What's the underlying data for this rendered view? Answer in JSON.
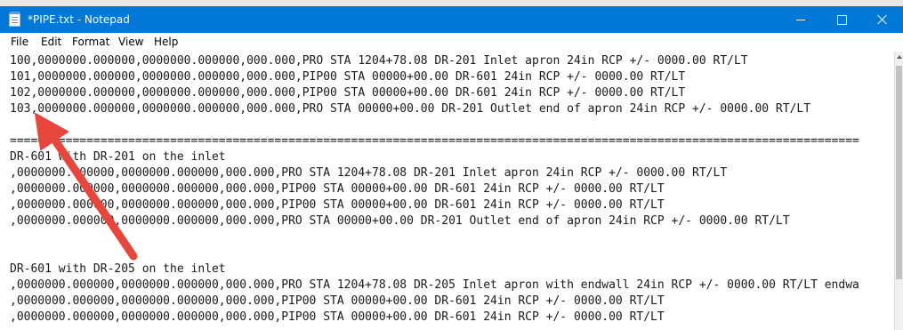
{
  "window": {
    "title": "*PIPE.txt - Notepad",
    "icon": "notepad-icon",
    "accent_color": "#0078d7"
  },
  "menu": {
    "items": [
      "File",
      "Edit",
      "Format",
      "View",
      "Help"
    ]
  },
  "editor": {
    "lines": [
      "100,0000000.000000,0000000.000000,000.000,PRO STA 1204+78.08 DR-201 Inlet apron 24in RCP +/- 0000.00 RT/LT",
      "101,0000000.000000,0000000.000000,000.000,PIP00 STA 00000+00.00 DR-601 24in RCP +/- 0000.00 RT/LT",
      "102,0000000.000000,0000000.000000,000.000,PIP00 STA 00000+00.00 DR-601 24in RCP +/- 0000.00 RT/LT",
      "103,0000000.000000,0000000.000000,000.000,PRO STA 00000+00.00 DR-201 Outlet end of apron 24in RCP +/- 0000.00 RT/LT",
      "",
      "==========================================================================================================================",
      "DR-601 with DR-201 on the inlet",
      ",0000000.000000,0000000.000000,000.000,PRO STA 1204+78.08 DR-201 Inlet apron 24in RCP +/- 0000.00 RT/LT",
      ",0000000.000000,0000000.000000,000.000,PIP00 STA 00000+00.00 DR-601 24in RCP +/- 0000.00 RT/LT",
      ",0000000.000000,0000000.000000,000.000,PIP00 STA 00000+00.00 DR-601 24in RCP +/- 0000.00 RT/LT",
      ",0000000.000000,0000000.000000,000.000,PRO STA 00000+00.00 DR-201 Outlet end of apron 24in RCP +/- 0000.00 RT/LT",
      "",
      "",
      "DR-601 with DR-205 on the inlet",
      ",0000000.000000,0000000.000000,000.000,PRO STA 1204+78.08 DR-205 Inlet apron with endwall 24in RCP +/- 0000.00 RT/LT endwa",
      ",0000000.000000,0000000.000000,000.000,PIP00 STA 00000+00.00 DR-601 24in RCP +/- 0000.00 RT/LT",
      ",0000000.000000,0000000.000000,000.000,PIP00 STA 00000+00.00 DR-601 24in RCP +/- 0000.00 RT/LT"
    ]
  },
  "annotation": {
    "icon": "red-arrow-icon",
    "color": "#e8463c"
  }
}
